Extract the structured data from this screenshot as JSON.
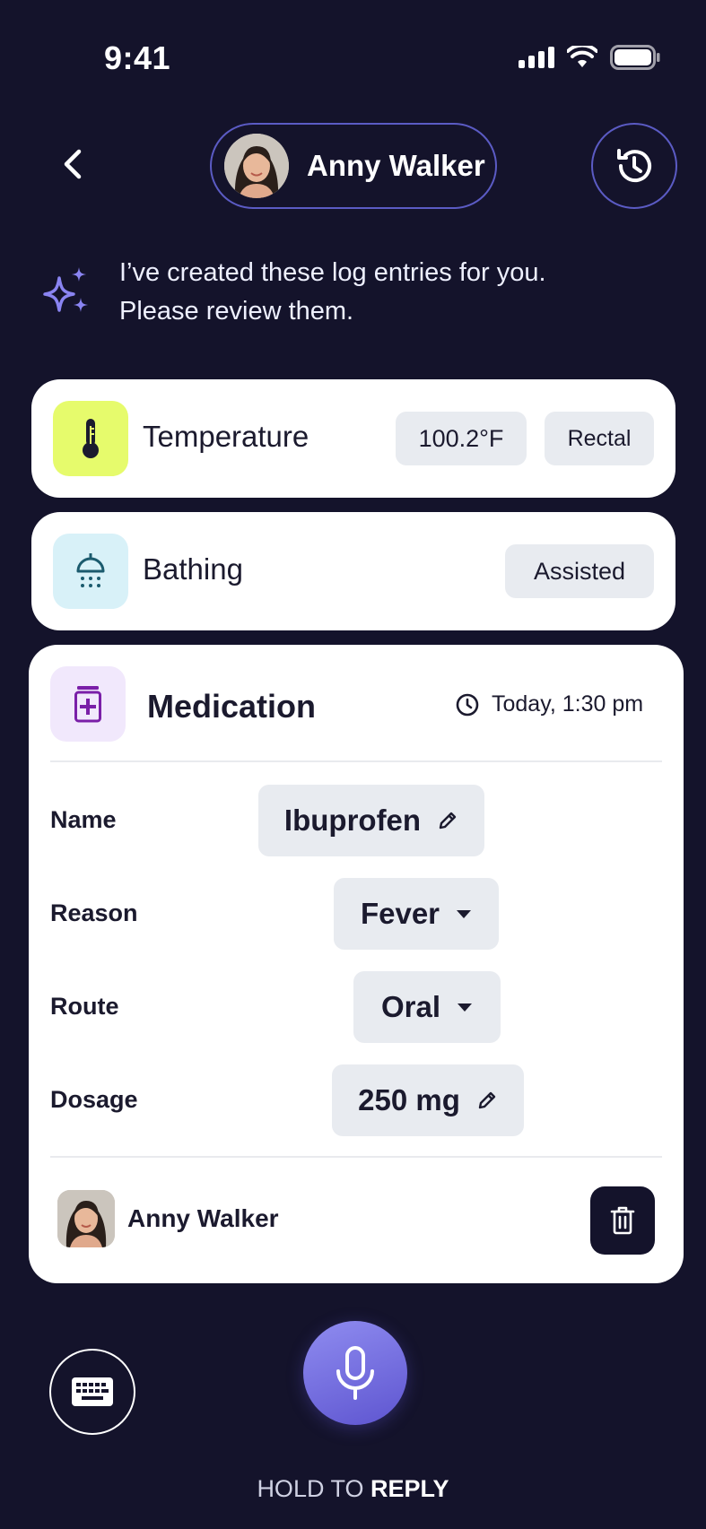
{
  "status_bar": {
    "time": "9:41"
  },
  "header": {
    "profile_name": "Anny Walker"
  },
  "assistant": {
    "message": "I’ve created these log entries for you. Please review them."
  },
  "entries": {
    "temperature": {
      "title": "Temperature",
      "value": "100.2°F",
      "method": "Rectal"
    },
    "bathing": {
      "title": "Bathing",
      "status": "Assisted"
    },
    "medication": {
      "title": "Medication",
      "time": "Today, 1:30 pm",
      "fields": {
        "name_label": "Name",
        "name_value": "Ibuprofen",
        "reason_label": "Reason",
        "reason_value": "Fever",
        "route_label": "Route",
        "route_value": "Oral",
        "dosage_label": "Dosage",
        "dosage_value": "250 mg"
      },
      "author": "Anny Walker"
    }
  },
  "footer": {
    "hold_text": "HOLD TO",
    "hold_emphasis": "REPLY"
  },
  "colors": {
    "background": "#14132b",
    "accent": "#7b74e6",
    "temp_tile": "#e6fb6c",
    "bath_tile": "#d8f1f8",
    "med_tile": "#f1e8fc",
    "med_icon": "#7a1fa8"
  }
}
